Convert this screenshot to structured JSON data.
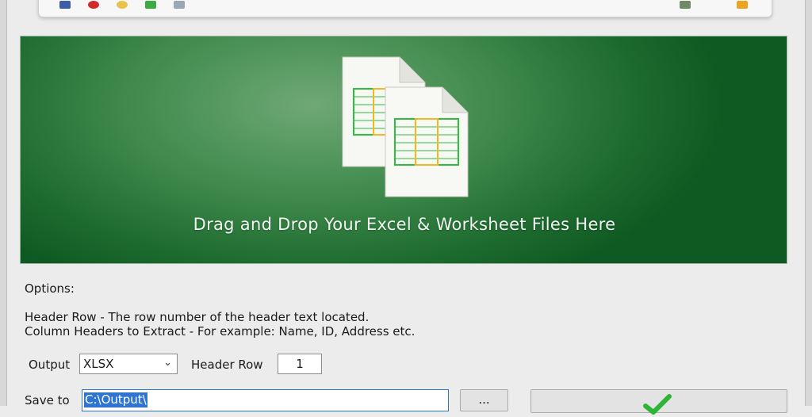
{
  "drop_zone": {
    "text": "Drag and Drop Your Excel & Worksheet Files Here"
  },
  "options": {
    "heading": "Options:",
    "help_line_1": "Header Row - The row number of the header text located.",
    "help_line_2": "Column Headers to Extract - For example: Name, ID, Address etc."
  },
  "output": {
    "label": "Output",
    "selected": "XLSX"
  },
  "header_row": {
    "label": "Header Row",
    "value": "1"
  },
  "save_to": {
    "label": "Save to",
    "value": "C:\\Output\\"
  },
  "browse_button": {
    "label": "..."
  },
  "colors": {
    "accent": "#2e74d3",
    "drop_zone_green": "#2f7d3d",
    "check_green": "#2fb536"
  }
}
